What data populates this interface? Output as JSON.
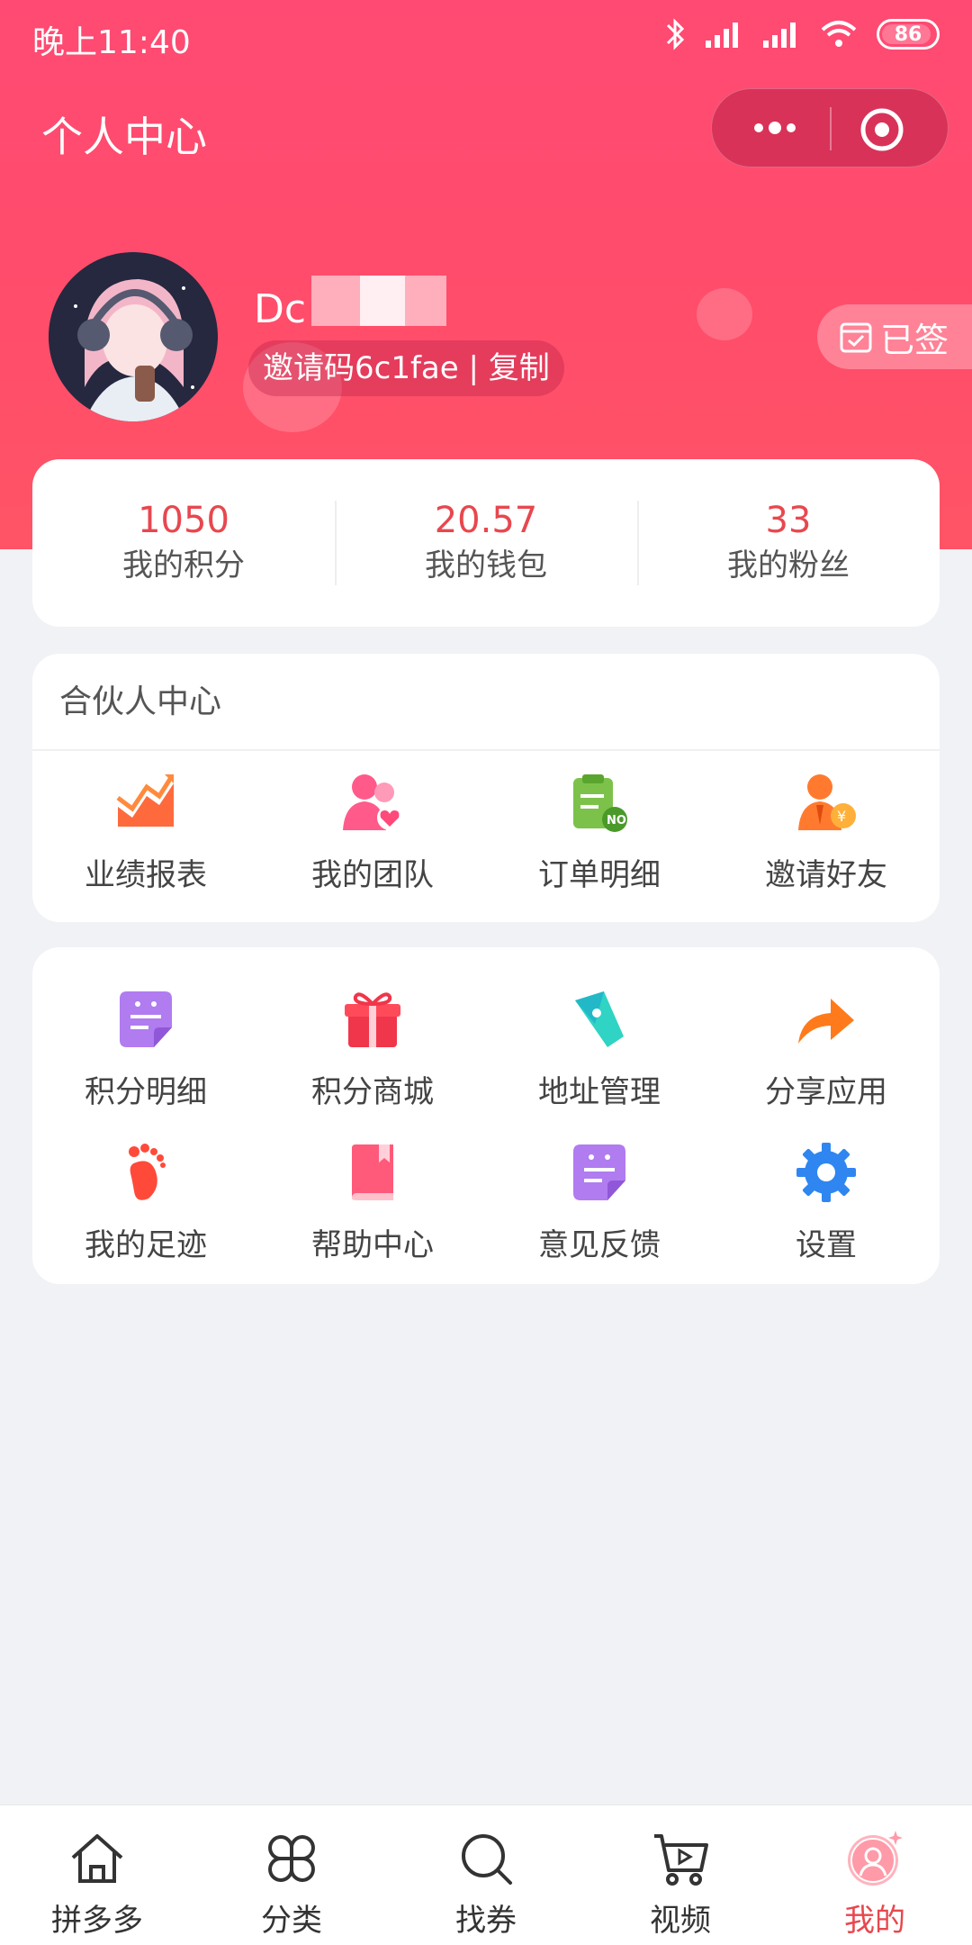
{
  "status_bar": {
    "time": "晚上11:40",
    "battery": "86"
  },
  "nav": {
    "title": "个人中心"
  },
  "profile": {
    "username": "Dc",
    "invite_text": "邀请码6c1fae | 复制",
    "signed_label": "已签"
  },
  "stats": [
    {
      "value": "1050",
      "label": "我的积分"
    },
    {
      "value": "20.57",
      "label": "我的钱包"
    },
    {
      "value": "33",
      "label": "我的粉丝"
    }
  ],
  "partner": {
    "title": "合伙人中心",
    "items": [
      {
        "label": "业绩报表",
        "icon": "chart-icon"
      },
      {
        "label": "我的团队",
        "icon": "team-icon"
      },
      {
        "label": "订单明细",
        "icon": "order-icon"
      },
      {
        "label": "邀请好友",
        "icon": "invite-icon"
      }
    ]
  },
  "tools": {
    "items": [
      {
        "label": "积分明细",
        "icon": "note-icon"
      },
      {
        "label": "积分商城",
        "icon": "gift-icon"
      },
      {
        "label": "地址管理",
        "icon": "location-icon"
      },
      {
        "label": "分享应用",
        "icon": "share-icon"
      },
      {
        "label": "我的足迹",
        "icon": "footprint-icon"
      },
      {
        "label": "帮助中心",
        "icon": "book-icon"
      },
      {
        "label": "意见反馈",
        "icon": "feedback-icon"
      },
      {
        "label": "设置",
        "icon": "gear-icon"
      }
    ]
  },
  "tabs": [
    {
      "label": "拼多多",
      "icon": "home-icon"
    },
    {
      "label": "分类",
      "icon": "category-icon"
    },
    {
      "label": "找券",
      "icon": "search-icon"
    },
    {
      "label": "视频",
      "icon": "video-cart-icon"
    },
    {
      "label": "我的",
      "icon": "profile-icon",
      "active": true
    }
  ],
  "colors": {
    "brand": "#ff4a73",
    "accent_text": "#e8474f",
    "background": "#f1f2f6"
  }
}
